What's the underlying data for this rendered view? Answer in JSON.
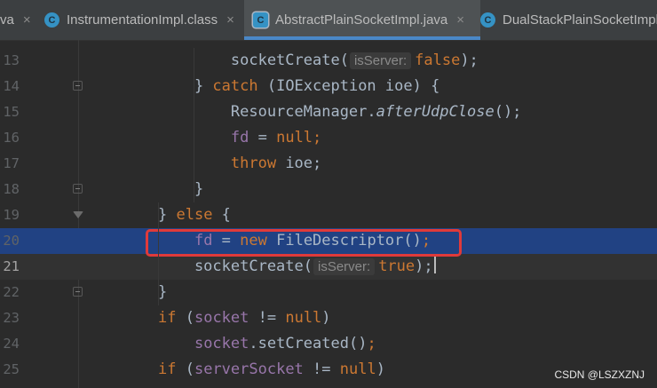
{
  "tabs": [
    {
      "label": "va",
      "icon": "none",
      "close": "×"
    },
    {
      "label": "InstrumentationImpl.class",
      "icon": "class-icon",
      "glyph": "C",
      "close": "×"
    },
    {
      "label": "AbstractPlainSocketImpl.java",
      "icon": "abstract-class-icon",
      "glyph": "C",
      "close": "×"
    },
    {
      "label": "DualStackPlainSocketImpl",
      "icon": "class-icon",
      "glyph": "C"
    }
  ],
  "editor": {
    "lines": [
      {
        "n": "13",
        "t": [
          [
            "        socketCreate(",
            "p"
          ],
          [
            "isServer:",
            "h"
          ],
          [
            "false",
            "k"
          ],
          [
            ");",
            "p"
          ]
        ]
      },
      {
        "n": "14",
        "t": [
          [
            "    } ",
            "p"
          ],
          [
            "catch",
            "k"
          ],
          [
            " (IOException ioe) {",
            "p"
          ]
        ]
      },
      {
        "n": "15",
        "t": [
          [
            "        ResourceManager.",
            "p"
          ],
          [
            "afterUdpClose",
            "i"
          ],
          [
            "();",
            "p"
          ]
        ]
      },
      {
        "n": "16",
        "t": [
          [
            "        ",
            "p"
          ],
          [
            "fd",
            "f"
          ],
          [
            " = ",
            "p"
          ],
          [
            "null",
            "k"
          ],
          [
            ";",
            "k"
          ]
        ]
      },
      {
        "n": "17",
        "t": [
          [
            "        ",
            "p"
          ],
          [
            "throw",
            "k"
          ],
          [
            " ioe;",
            "p"
          ]
        ]
      },
      {
        "n": "18",
        "t": [
          [
            "    }",
            "p"
          ]
        ]
      },
      {
        "n": "19",
        "t": [
          [
            "} ",
            "p"
          ],
          [
            "else",
            "k"
          ],
          [
            " {",
            "p"
          ]
        ]
      },
      {
        "n": "20",
        "t": [
          [
            "    ",
            "p"
          ],
          [
            "fd",
            "f"
          ],
          [
            " = ",
            "p"
          ],
          [
            "new",
            "k"
          ],
          [
            " FileDescriptor()",
            "p"
          ],
          [
            ";",
            "k"
          ]
        ]
      },
      {
        "n": "21",
        "t": [
          [
            "    socketCreate(",
            "p"
          ],
          [
            "isServer:",
            "h"
          ],
          [
            "true",
            "k"
          ],
          [
            ");",
            "p"
          ]
        ]
      },
      {
        "n": "22",
        "t": [
          [
            "}",
            "p"
          ]
        ]
      },
      {
        "n": "23",
        "t": [
          [
            "if",
            "k"
          ],
          [
            " (",
            "p"
          ],
          [
            "socket",
            "f"
          ],
          [
            " != ",
            "p"
          ],
          [
            "null",
            "k"
          ],
          [
            ")",
            "p"
          ]
        ]
      },
      {
        "n": "24",
        "t": [
          [
            "    ",
            "p"
          ],
          [
            "socket",
            "f"
          ],
          [
            ".setCreated()",
            "p"
          ],
          [
            ";",
            "k"
          ]
        ]
      },
      {
        "n": "25",
        "t": [
          [
            "if",
            "k"
          ],
          [
            " (",
            "p"
          ],
          [
            "serverSocket",
            "f"
          ],
          [
            " != ",
            "p"
          ],
          [
            "null",
            "k"
          ],
          [
            ")",
            "p"
          ]
        ]
      }
    ],
    "selected_line": "20",
    "caret_line": "21"
  },
  "colors": {
    "keyword": "#cc7832",
    "field": "#9876aa",
    "plain": "#a9b7c6",
    "selection": "#214283",
    "highlight_box": "#e03a3a"
  },
  "watermark": "CSDN @LSZXZNJ"
}
